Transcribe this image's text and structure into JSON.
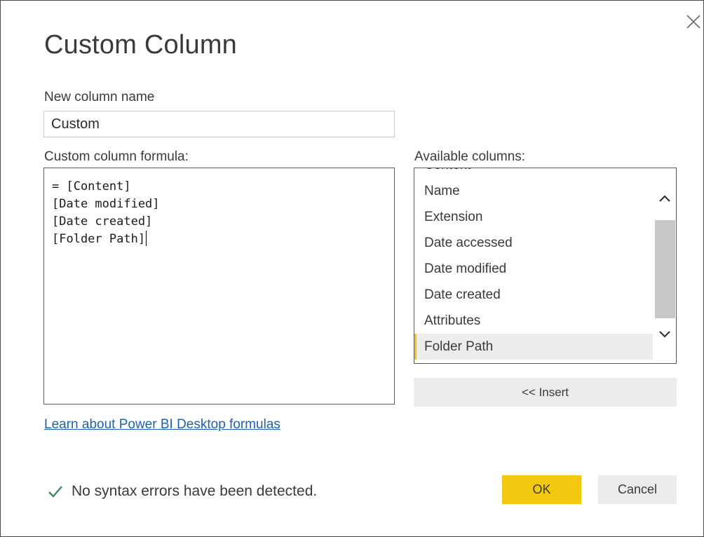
{
  "dialog": {
    "title": "Custom Column",
    "close_icon": "close-icon"
  },
  "new_column": {
    "label": "New column name",
    "value": "Custom"
  },
  "formula": {
    "label": "Custom column formula:",
    "lines": [
      "= [Content]",
      "[Date modified]",
      "[Date created]",
      "[Folder Path]"
    ]
  },
  "available_columns": {
    "label": "Available columns:",
    "items": [
      "Content",
      "Name",
      "Extension",
      "Date accessed",
      "Date modified",
      "Date created",
      "Attributes",
      "Folder Path"
    ],
    "selected": "Folder Path",
    "scroll_up_icon": "chevron-up-icon",
    "scroll_down_icon": "chevron-down-icon"
  },
  "insert_button": {
    "label": "<< Insert"
  },
  "learn_link": {
    "text": "Learn about Power BI Desktop formulas"
  },
  "status": {
    "icon": "checkmark-icon",
    "text": "No syntax errors have been detected."
  },
  "buttons": {
    "ok": "OK",
    "cancel": "Cancel"
  },
  "colors": {
    "accent": "#f2c811",
    "link": "#1a62b8",
    "success": "#3a8a5c",
    "button_gray": "#ececec"
  }
}
